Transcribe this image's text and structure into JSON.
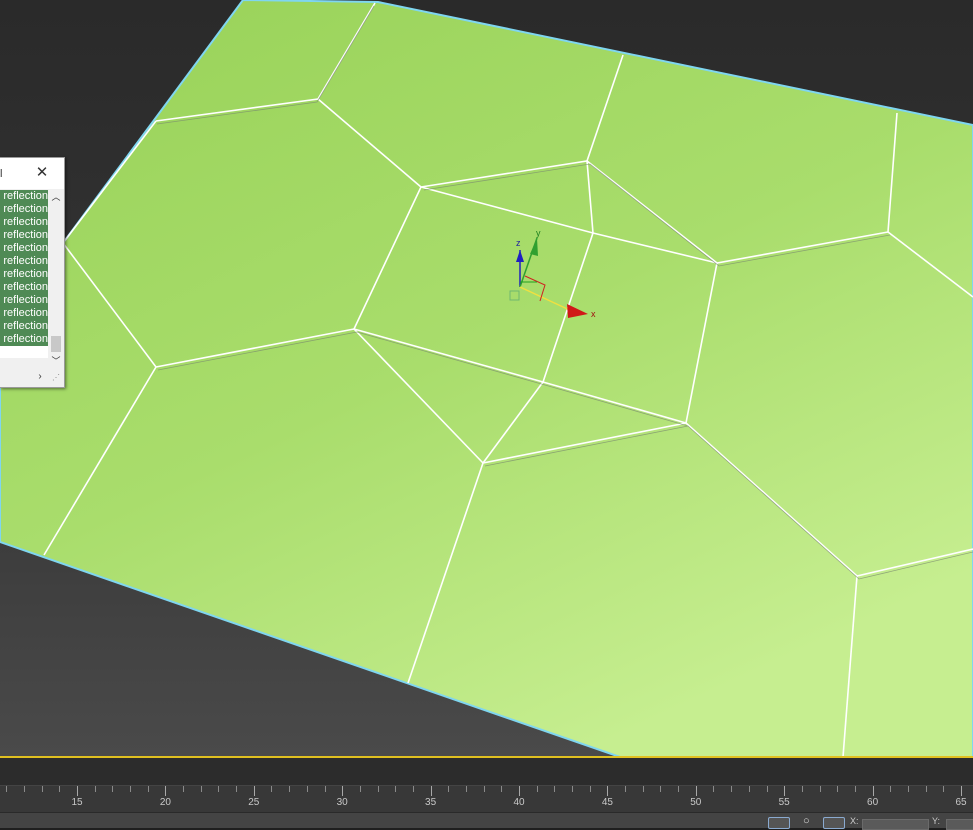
{
  "viewport": {
    "name": "3D perspective viewport",
    "gizmo": {
      "x_label": "x",
      "y_label": "y",
      "z_label": "z"
    },
    "colors": {
      "surface_light": "#c6ee90",
      "surface_dark": "#98d258",
      "edge": "#ffffff",
      "selection_outline": "#7fd6f0",
      "viewport_active_border": "#e0c020"
    }
  },
  "float_panel": {
    "title_fragment": "l",
    "close_icon": "close-icon",
    "items": [
      "highlight and reflection",
      "highlight and reflection",
      "highlight and reflection",
      "highlight and reflection",
      "highlight and reflection",
      "highlight and reflection",
      "highlight and reflection",
      "highlight and reflection",
      "highlight and reflection",
      "highlight and reflection",
      "highlight and reflection",
      "highlight and reflection"
    ],
    "scroll_up_icon": "chevron-up-icon",
    "scroll_down_icon": "chevron-down-icon",
    "scroll_right_icon": "chevron-right-icon"
  },
  "timeline": {
    "tick_labels": [
      "15",
      "20",
      "25",
      "30",
      "35",
      "40",
      "45",
      "50",
      "55",
      "60",
      "65"
    ],
    "frames_per_label": 5
  },
  "statusbar": {
    "icons": [
      "selection-lock-icon",
      "isolate-icon",
      "absolute-mode-icon"
    ],
    "x_label": "X:",
    "y_label": "Y:"
  }
}
